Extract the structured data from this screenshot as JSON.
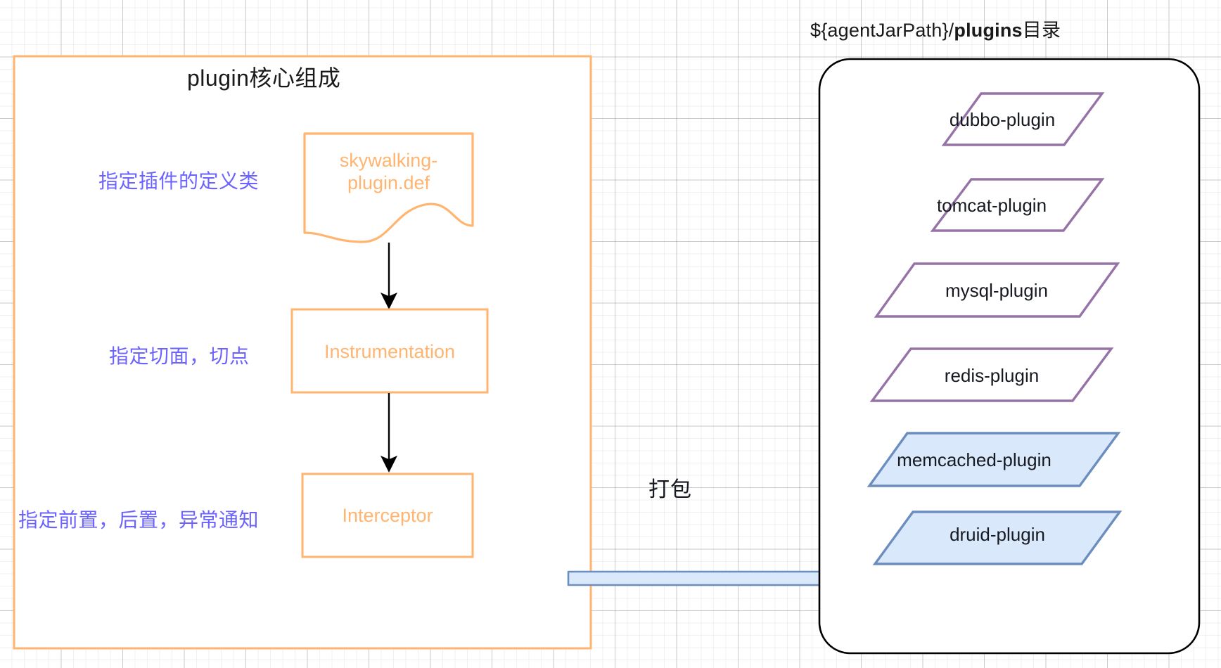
{
  "diagram": {
    "left_group": {
      "title": "plugin核心组成",
      "nodes": [
        {
          "id": "def",
          "label": "skywalking-\nplugin.def",
          "line1": "skywalking-",
          "line2": "plugin.def",
          "shape": "document"
        },
        {
          "id": "instrumentation",
          "label": "Instrumentation",
          "shape": "rectangle"
        },
        {
          "id": "interceptor",
          "label": "Interceptor",
          "shape": "rectangle"
        }
      ],
      "annotations": [
        {
          "id": "def-note",
          "text": "指定插件的定义类"
        },
        {
          "id": "instrumentation-note",
          "text": "指定切面，切点"
        },
        {
          "id": "interceptor-note",
          "text": "指定前置，后置，异常通知"
        }
      ],
      "colors": {
        "border": "#ffb570",
        "node_text": "#ffb570",
        "annotation_text": "#6c63ff",
        "title_text": "#1a1a1a",
        "arrow": "#000000"
      }
    },
    "connector": {
      "label": "打包",
      "shape": "block-arrow",
      "fill": "#dae8fc",
      "stroke": "#6c8ebf"
    },
    "right_group": {
      "title_prefix": "${agentJarPath}/",
      "title_bold": "plugins",
      "title_suffix": "目录",
      "container_stroke": "#000000",
      "plugins": [
        {
          "label": "dubbo-plugin",
          "fill": "none",
          "stroke": "#9673a6"
        },
        {
          "label": "tomcat-plugin",
          "fill": "none",
          "stroke": "#9673a6"
        },
        {
          "label": "mysql-plugin",
          "fill": "none",
          "stroke": "#9673a6"
        },
        {
          "label": "redis-plugin",
          "fill": "none",
          "stroke": "#9673a6"
        },
        {
          "label": "memcached-plugin",
          "fill": "#dae8fc",
          "stroke": "#6c8ebf"
        },
        {
          "label": "druid-plugin",
          "fill": "#dae8fc",
          "stroke": "#6c8ebf"
        }
      ]
    }
  }
}
